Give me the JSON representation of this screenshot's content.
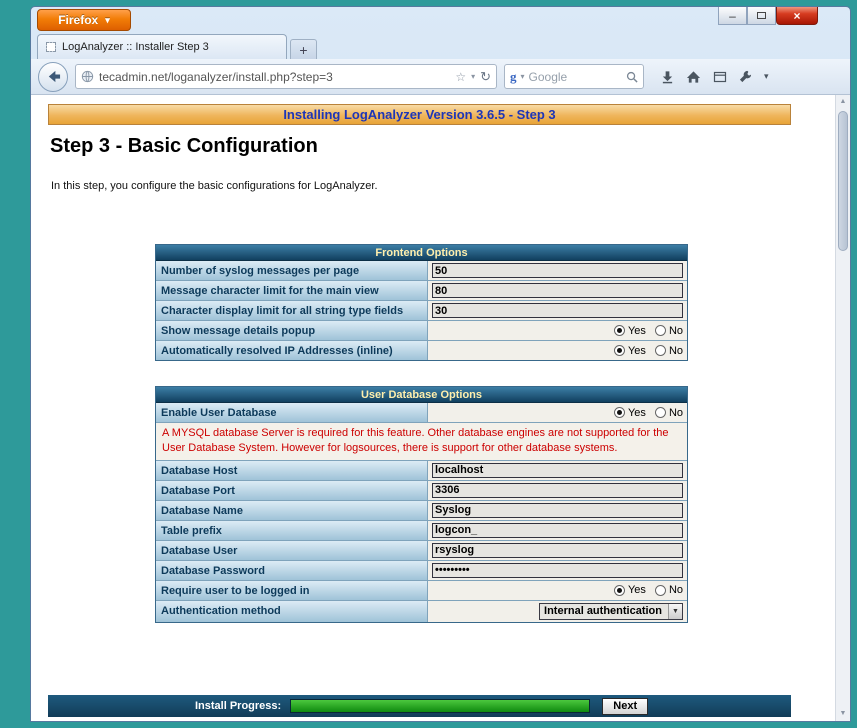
{
  "colors": {
    "desktop": "#2E9A9A",
    "firefox_orange": "#F27D07",
    "banner_text": "#1D35B8",
    "table_header_bg": "#11405F",
    "warning_text": "#CC0000",
    "progress_green": "#0F8A0F",
    "footer_bg": "#123C58"
  },
  "browser": {
    "app_button": "Firefox",
    "window_controls": {
      "minimize": "–",
      "close": "×"
    },
    "tab": {
      "title": "LogAnalyzer :: Installer Step 3"
    },
    "new_tab": "+",
    "nav": {
      "url": "tecadmin.net/loganalyzer/install.php?step=3",
      "search_placeholder": "Google"
    }
  },
  "page": {
    "banner": "Installing LogAnalyzer Version 3.6.5 - Step 3",
    "heading": "Step 3 - Basic Configuration",
    "intro": "In this step, you configure the basic configurations for LogAnalyzer.",
    "radio_yes": "Yes",
    "radio_no": "No",
    "sections": [
      {
        "header": "Frontend Options",
        "rows": [
          {
            "label": "Number of syslog messages per page",
            "type": "text",
            "value": "50"
          },
          {
            "label": "Message character limit for the main view",
            "type": "text",
            "value": "80"
          },
          {
            "label": "Character display limit for all string type fields",
            "type": "text",
            "value": "30"
          },
          {
            "label": "Show message details popup",
            "type": "radio",
            "selected": "Yes"
          },
          {
            "label": "Automatically resolved IP Addresses (inline)",
            "type": "radio",
            "selected": "Yes"
          }
        ]
      },
      {
        "header": "User Database Options",
        "rows": [
          {
            "label": "Enable User Database",
            "type": "radio",
            "selected": "Yes"
          },
          {
            "type": "warning",
            "text": "A MYSQL database Server is required for this feature. Other database engines are not supported for the User Database System. However for logsources, there is support for other database systems."
          },
          {
            "label": "Database Host",
            "type": "text",
            "value": "localhost"
          },
          {
            "label": "Database Port",
            "type": "text",
            "value": "3306"
          },
          {
            "label": "Database Name",
            "type": "text",
            "value": "Syslog"
          },
          {
            "label": "Table prefix",
            "type": "text",
            "value": "logcon_"
          },
          {
            "label": "Database User",
            "type": "text",
            "value": "rsyslog"
          },
          {
            "label": "Database Password",
            "type": "password",
            "value": "•••••••••"
          },
          {
            "label": "Require user to be logged in",
            "type": "radio",
            "selected": "Yes"
          },
          {
            "label": "Authentication method",
            "type": "select",
            "value": "Internal authentication"
          }
        ]
      }
    ],
    "footer": {
      "progress_label": "Install Progress:",
      "next_label": "Next",
      "progress_percent": 100
    }
  }
}
